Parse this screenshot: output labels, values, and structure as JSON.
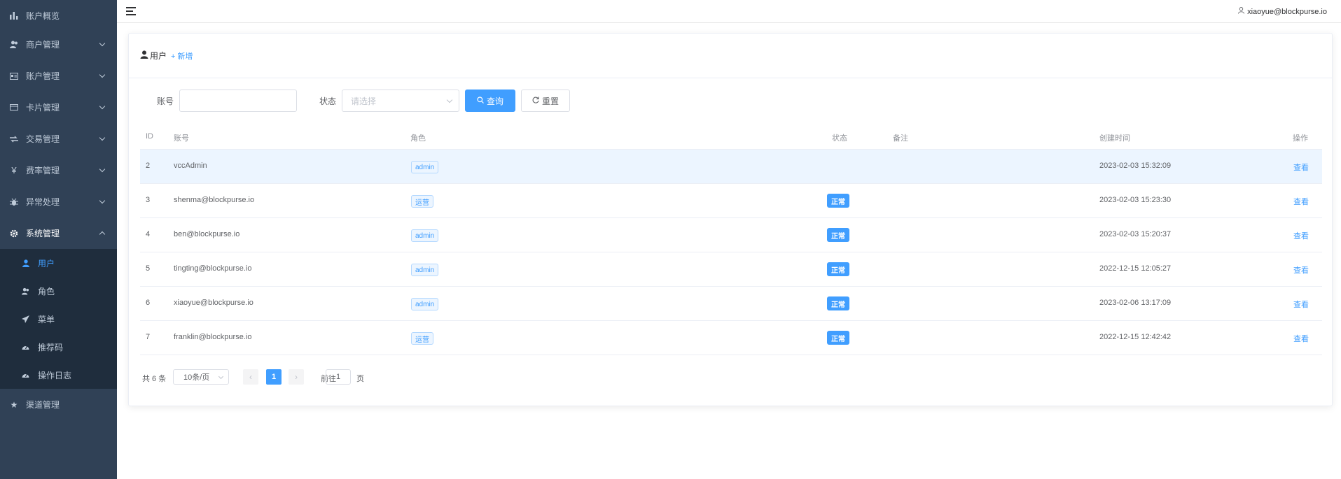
{
  "sidebar": {
    "items": [
      {
        "label": "账户概览",
        "icon": "bar-chart-icon"
      },
      {
        "label": "商户管理",
        "icon": "users-icon"
      },
      {
        "label": "账户管理",
        "icon": "id-card-icon"
      },
      {
        "label": "卡片管理",
        "icon": "card-icon"
      },
      {
        "label": "交易管理",
        "icon": "exchange-icon"
      },
      {
        "label": "费率管理",
        "icon": "yen-icon"
      },
      {
        "label": "异常处理",
        "icon": "bug-icon"
      },
      {
        "label": "系统管理",
        "icon": "gear-icon"
      },
      {
        "label": "渠道管理",
        "icon": "star-icon"
      }
    ],
    "sub_items": [
      {
        "label": "用户",
        "icon": "user-icon"
      },
      {
        "label": "角色",
        "icon": "users-icon"
      },
      {
        "label": "菜单",
        "icon": "send-icon"
      },
      {
        "label": "推荐码",
        "icon": "dashboard-icon"
      },
      {
        "label": "操作日志",
        "icon": "dashboard-icon"
      }
    ]
  },
  "header": {
    "user": "xiaoyue@blockpurse.io"
  },
  "card": {
    "title": "用户",
    "add_label": "+ 新增"
  },
  "search": {
    "account_label": "账号",
    "account_value": "",
    "status_label": "状态",
    "status_placeholder": "请选择",
    "query_label": "查询",
    "reset_label": "重置"
  },
  "table": {
    "columns": [
      "ID",
      "账号",
      "角色",
      "状态",
      "备注",
      "创建时间",
      "操作"
    ],
    "rows": [
      {
        "id": "2",
        "account": "vccAdmin",
        "role": "admin",
        "status": "",
        "remark": "",
        "created": "2023-02-03 15:32:09",
        "action": "查看"
      },
      {
        "id": "3",
        "account": "shenma@blockpurse.io",
        "role": "运营",
        "status": "正常",
        "remark": "",
        "created": "2023-02-03 15:23:30",
        "action": "查看"
      },
      {
        "id": "4",
        "account": "ben@blockpurse.io",
        "role": "admin",
        "status": "正常",
        "remark": "",
        "created": "2023-02-03 15:20:37",
        "action": "查看"
      },
      {
        "id": "5",
        "account": "tingting@blockpurse.io",
        "role": "admin",
        "status": "正常",
        "remark": "",
        "created": "2022-12-15 12:05:27",
        "action": "查看"
      },
      {
        "id": "6",
        "account": "xiaoyue@blockpurse.io",
        "role": "admin",
        "status": "正常",
        "remark": "",
        "created": "2023-02-06 13:17:09",
        "action": "查看"
      },
      {
        "id": "7",
        "account": "franklin@blockpurse.io",
        "role": "运营",
        "status": "正常",
        "remark": "",
        "created": "2022-12-15 12:42:42",
        "action": "查看"
      }
    ]
  },
  "pagination": {
    "total": "共 6 条",
    "page_size": "10条/页",
    "current_page": "1",
    "goto_label": "前往",
    "goto_value": "1",
    "page_suffix": "页"
  },
  "colors": {
    "sidebar_bg": "#304156",
    "submenu_bg": "#1f2d3d",
    "accent": "#409eff"
  }
}
